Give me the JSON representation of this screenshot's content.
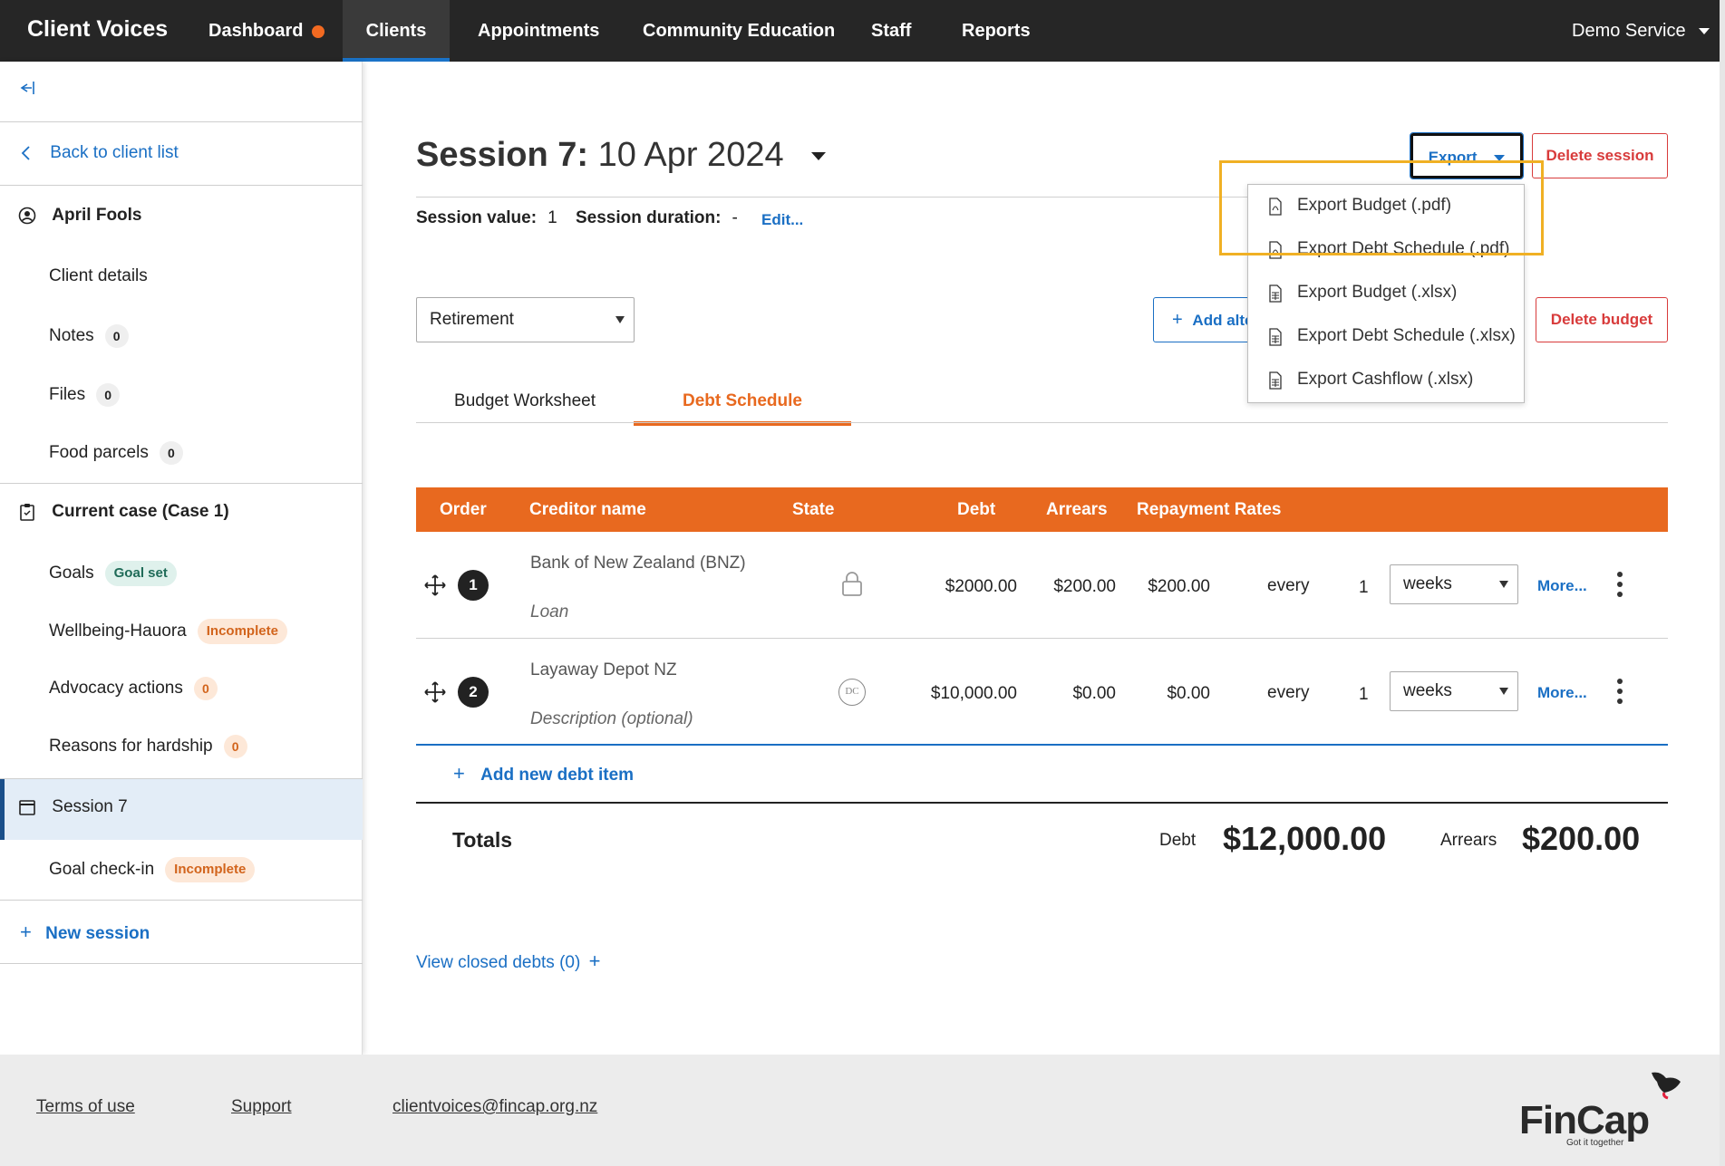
{
  "nav": {
    "brand": "Client Voices",
    "items": [
      "Dashboard",
      "Clients",
      "Appointments",
      "Community Education",
      "Staff",
      "Reports"
    ],
    "service": "Demo Service"
  },
  "sidebar": {
    "back": "Back to client list",
    "client_name": "April Fools",
    "client_details": "Client details",
    "notes": "Notes",
    "notes_count": "0",
    "files": "Files",
    "files_count": "0",
    "food": "Food parcels",
    "food_count": "0",
    "case": "Current case (Case 1)",
    "goals": "Goals",
    "goals_badge": "Goal set",
    "wellbeing": "Wellbeing-Hauora",
    "wellbeing_badge": "Incomplete",
    "advocacy": "Advocacy actions",
    "advocacy_count": "0",
    "reasons": "Reasons for hardship",
    "reasons_count": "0",
    "session": "Session 7",
    "goal_checkin": "Goal check-in",
    "goal_checkin_badge": "Incomplete",
    "new_session": "New session"
  },
  "main": {
    "title_bold": "Session 7:",
    "title_date": "10 Apr 2024",
    "export": "Export",
    "delete_session": "Delete session",
    "session_value_label": "Session value:",
    "session_value": "1",
    "session_duration_label": "Session duration:",
    "session_duration": "-",
    "edit": "Edit...",
    "budget_select": "Retirement",
    "add_alt": "Add alte",
    "delete_budget": "Delete budget",
    "tabs": [
      "Budget Worksheet",
      "Debt Schedule"
    ]
  },
  "table": {
    "headers": [
      "Order",
      "Creditor name",
      "State",
      "Debt",
      "Arrears",
      "Repayment Rates"
    ],
    "rows": [
      {
        "order": "1",
        "creditor": "Bank of New Zealand (BNZ)",
        "desc": "Loan",
        "debt": "$2000.00",
        "arrears": "$200.00",
        "rate": "$200.00",
        "every": "every",
        "n": "1",
        "period": "weeks",
        "more": "More..."
      },
      {
        "order": "2",
        "creditor": "Layaway Depot NZ",
        "desc": "Description (optional)",
        "state_label": "DC",
        "debt": "$10,000.00",
        "arrears": "$0.00",
        "rate": "$0.00",
        "every": "every",
        "n": "1",
        "period": "weeks",
        "more": "More..."
      }
    ],
    "add_new": "Add new debt item",
    "totals_label": "Totals",
    "debt_label": "Debt",
    "debt_total": "$12,000.00",
    "arrears_label": "Arrears",
    "arrears_total": "$200.00",
    "closed": "View closed debts (0)"
  },
  "export_menu": [
    "Export Budget (.pdf)",
    "Export Debt Schedule (.pdf)",
    "Export Budget (.xlsx)",
    "Export Debt Schedule (.xlsx)",
    "Export Cashflow (.xlsx)"
  ],
  "footer": {
    "terms": "Terms of use",
    "support": "Support",
    "email": "clientvoices@fincap.org.nz",
    "logo": "FinCap",
    "tagline": "Got it together"
  },
  "colors": {
    "accent": "#e8691f",
    "link": "#1a6fc4",
    "danger": "#d83b3b",
    "nav_bg": "#262626"
  }
}
